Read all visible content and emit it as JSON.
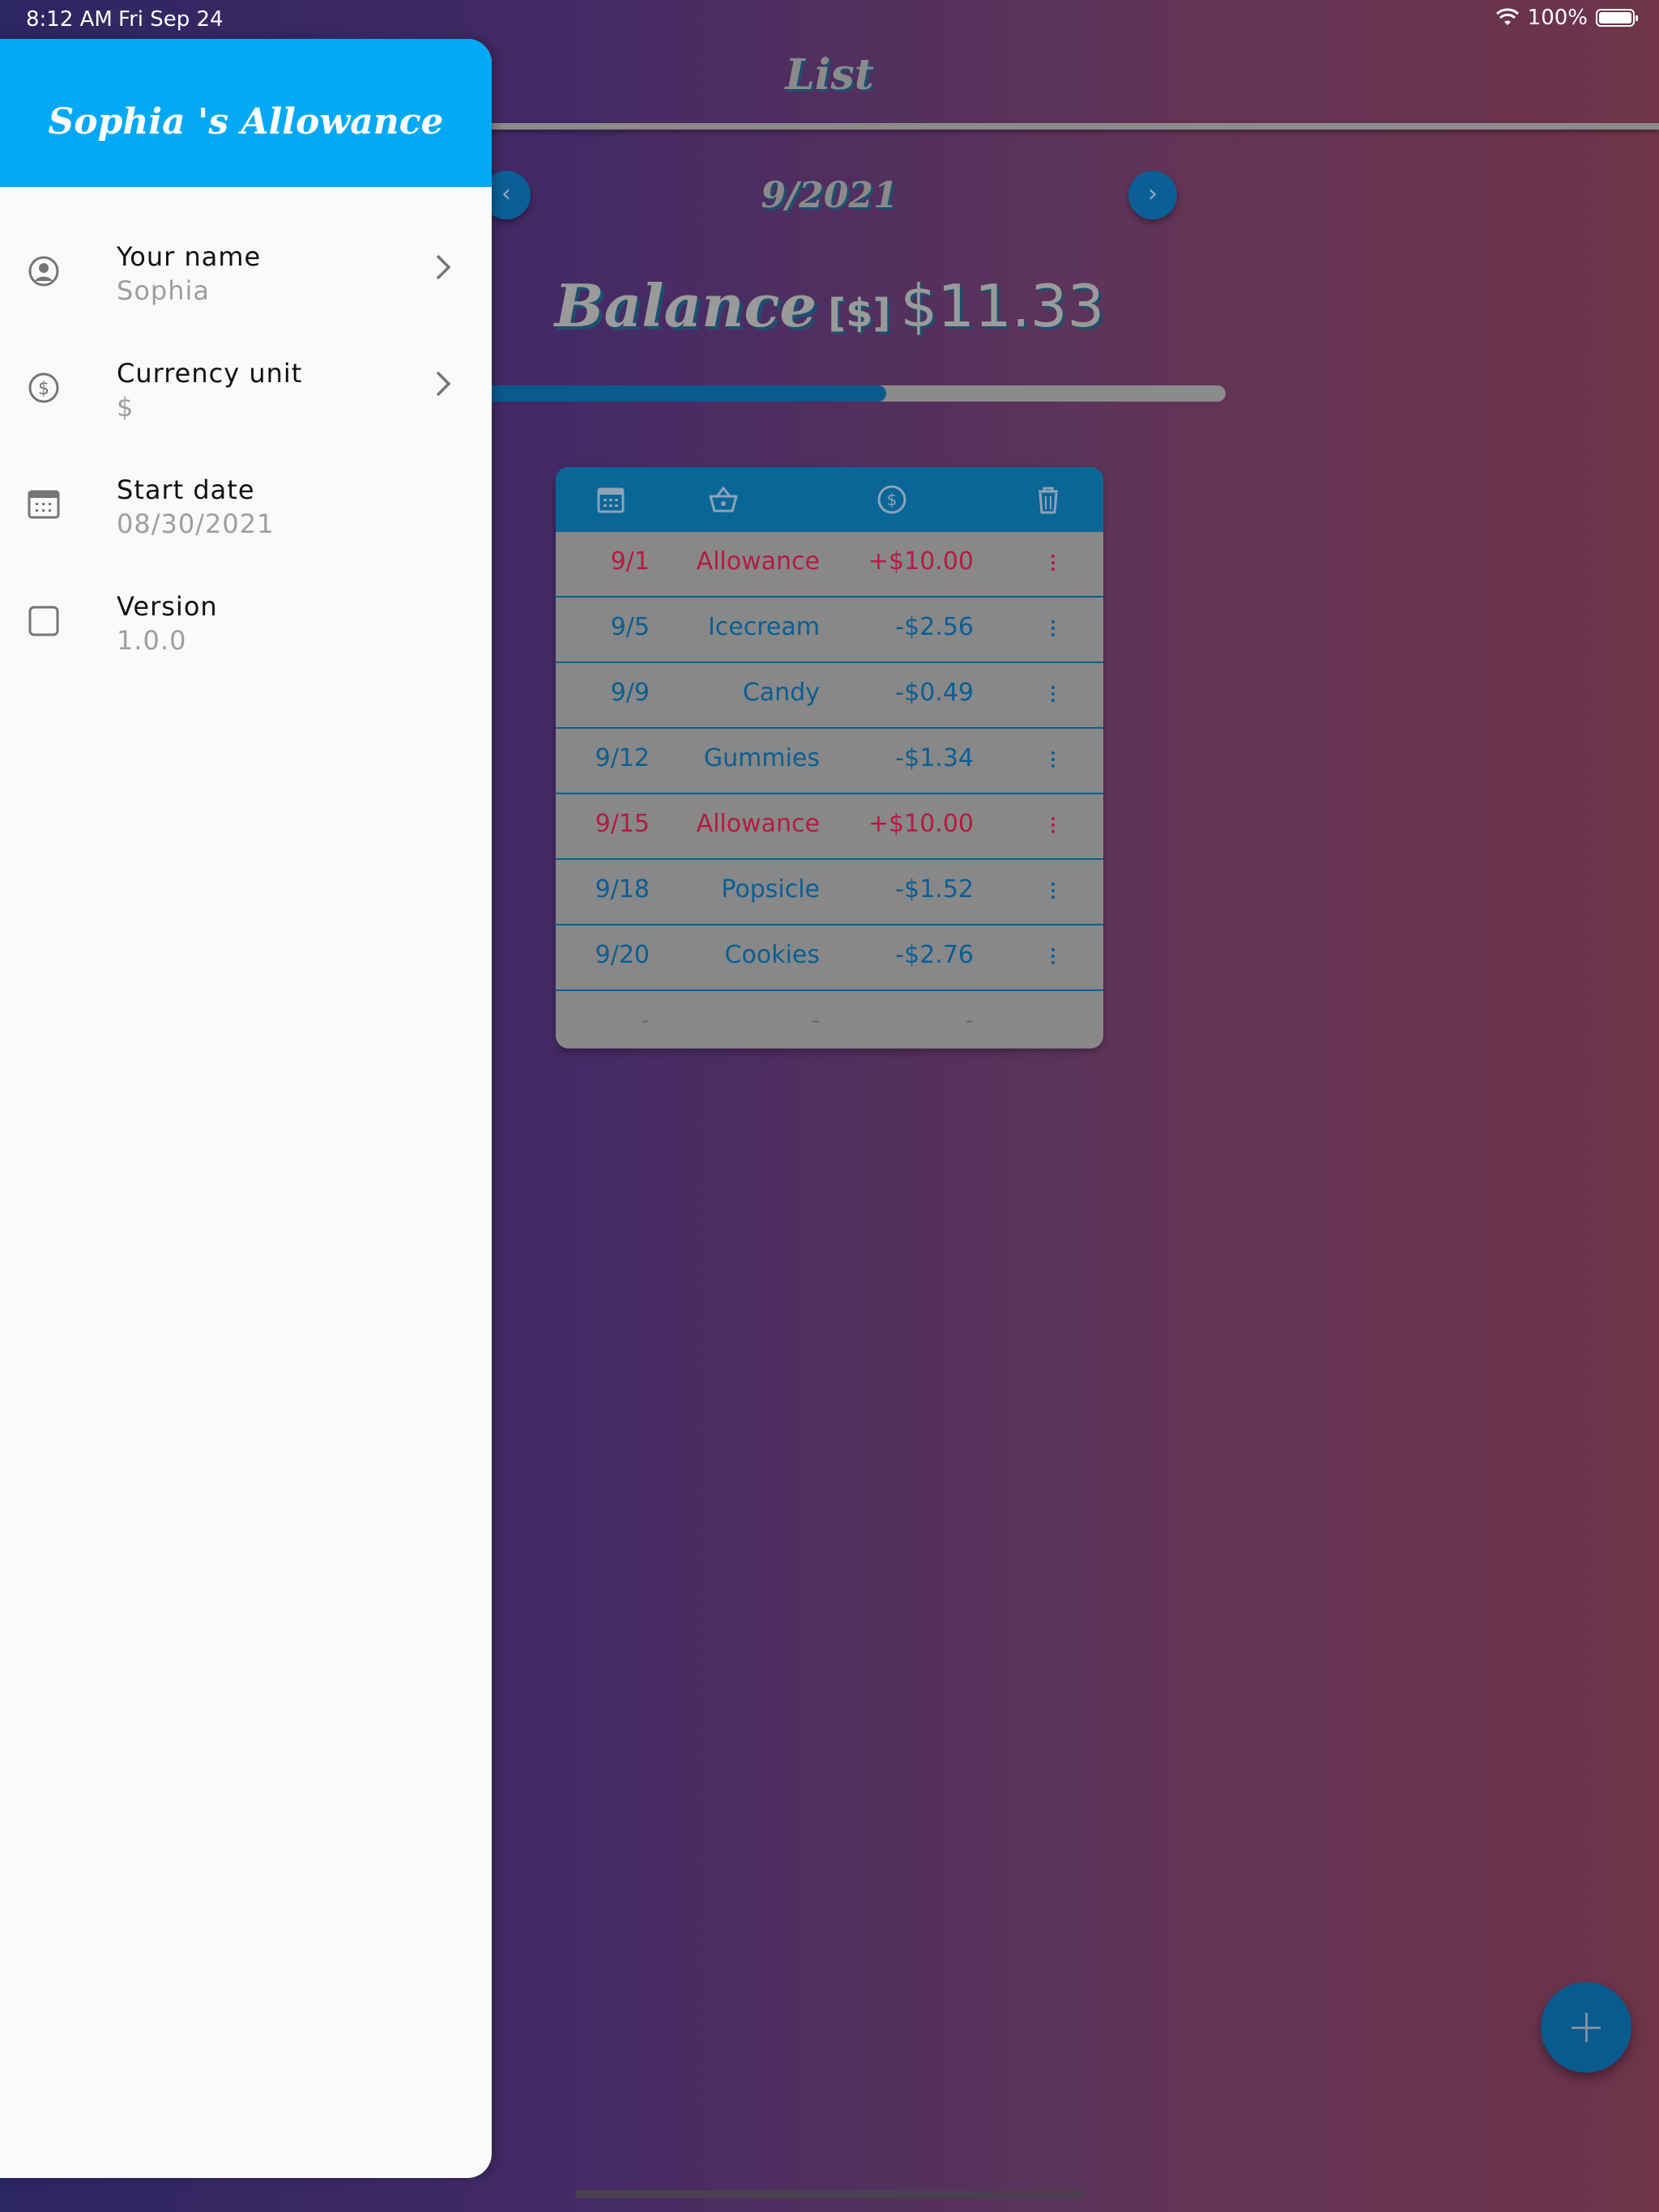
{
  "status_bar": {
    "time": "8:12 AM",
    "date": "Fri Sep 24",
    "battery": "100%"
  },
  "app_bar": {
    "title": "List"
  },
  "month_nav": {
    "label": "9/2021",
    "prev_icon": "chevron-left-icon",
    "next_icon": "chevron-right-icon"
  },
  "balance": {
    "label": "Balance",
    "unit": "[$]",
    "amount": "$11.33",
    "progress_fraction": 0.56
  },
  "table": {
    "header_icons": [
      "calendar-icon",
      "basket-icon",
      "dollar-circle-icon",
      "trash-icon"
    ],
    "rows": [
      {
        "date": "9/1",
        "name": "Allowance",
        "amount": "+$10.00",
        "type": "income"
      },
      {
        "date": "9/5",
        "name": "Icecream",
        "amount": "-$2.56",
        "type": "expense"
      },
      {
        "date": "9/9",
        "name": "Candy",
        "amount": "-$0.49",
        "type": "expense"
      },
      {
        "date": "9/12",
        "name": "Gummies",
        "amount": "-$1.34",
        "type": "expense"
      },
      {
        "date": "9/15",
        "name": "Allowance",
        "amount": "+$10.00",
        "type": "income"
      },
      {
        "date": "9/18",
        "name": "Popsicle",
        "amount": "-$1.52",
        "type": "expense"
      },
      {
        "date": "9/20",
        "name": "Cookies",
        "amount": "-$2.76",
        "type": "expense"
      }
    ],
    "empty_row": {
      "date": "-",
      "name": "-",
      "amount": "-"
    }
  },
  "drawer": {
    "title": "Sophia 's Allowance",
    "items": [
      {
        "label": "Your name",
        "value": "Sophia",
        "icon": "user-circle-icon"
      },
      {
        "label": "Currency unit",
        "value": "$",
        "icon": "dollar-circle-icon"
      },
      {
        "label": "Start date",
        "value": "08/30/2021",
        "icon": "calendar-icon"
      },
      {
        "label": "Version",
        "value": "1.0.0",
        "icon": "square-icon"
      }
    ]
  },
  "fab": {
    "icon": "plus-icon"
  },
  "colors": {
    "drawer_header": "#03a9f4",
    "income": "#b51a44",
    "expense": "#0a5f92",
    "accent": "#0b5a8e"
  }
}
